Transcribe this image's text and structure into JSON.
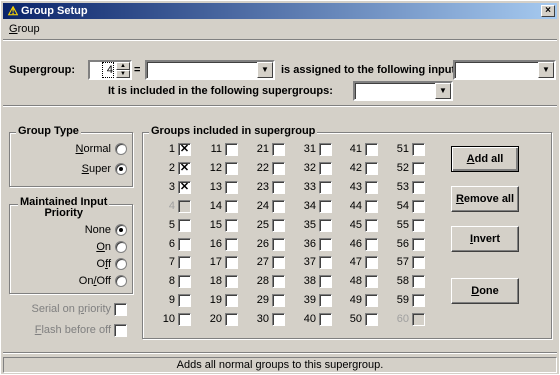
{
  "window": {
    "title": "Group Setup",
    "close_glyph": "×"
  },
  "menu": {
    "group_label": "Group",
    "group_mnemonic": "G"
  },
  "supergroup": {
    "label": "Supergroup:",
    "value": "4",
    "equals": "=",
    "name_value": "",
    "assigned_text": "is assigned to the following inputs:",
    "inputs_value": "",
    "included_text": "It is included in the following supergroups:",
    "supergroups_value": ""
  },
  "group_type": {
    "title": "Group Type",
    "options": [
      {
        "label": "Normal",
        "selected": false
      },
      {
        "label": "Super",
        "selected": true
      }
    ]
  },
  "maintained": {
    "title_line1": "Maintained Input",
    "title_line2": "Priority",
    "options": [
      {
        "label": "None",
        "selected": true
      },
      {
        "label": "On",
        "selected": false
      },
      {
        "label": "Off",
        "selected": false
      },
      {
        "label": "On/Off",
        "selected": false
      }
    ]
  },
  "serial_on_priority": {
    "label": "Serial on priority",
    "checked": false
  },
  "flash_before_off": {
    "label": "Flash before off",
    "checked": false
  },
  "groups": {
    "title": "Groups included in supergroup",
    "checked": [
      1,
      2,
      3
    ],
    "disabled": [
      4,
      60
    ],
    "check_glyph": "✕"
  },
  "buttons": {
    "add_all": "Add all",
    "remove_all": "Remove all",
    "invert": "Invert",
    "done": "Done"
  },
  "status": "Adds all normal groups to this supergroup.",
  "colors": {
    "title_start": "#0a246a",
    "title_end": "#a6caf0",
    "face": "#d4d0c8"
  }
}
